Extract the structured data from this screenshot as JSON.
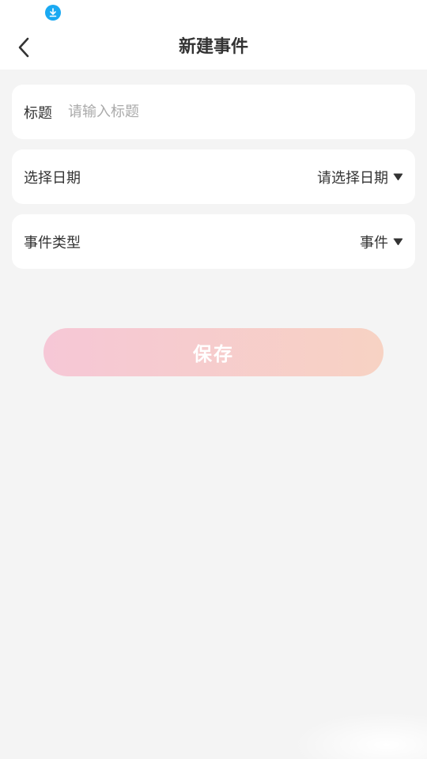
{
  "status_bar": {
    "icons": [
      "download-icon"
    ],
    "accent_color": "#1aa9f2"
  },
  "header": {
    "title": "新建事件",
    "back_icon": "chevron-left-icon"
  },
  "form": {
    "title_field": {
      "label": "标题",
      "value": "",
      "placeholder": "请输入标题"
    },
    "date_field": {
      "label": "选择日期",
      "value": "请选择日期",
      "icon": "caret-down-icon"
    },
    "type_field": {
      "label": "事件类型",
      "value": "事件",
      "icon": "caret-down-icon"
    }
  },
  "actions": {
    "save_label": "保存",
    "save_gradient": [
      "#f6c7d6",
      "#f7d2c3"
    ]
  }
}
